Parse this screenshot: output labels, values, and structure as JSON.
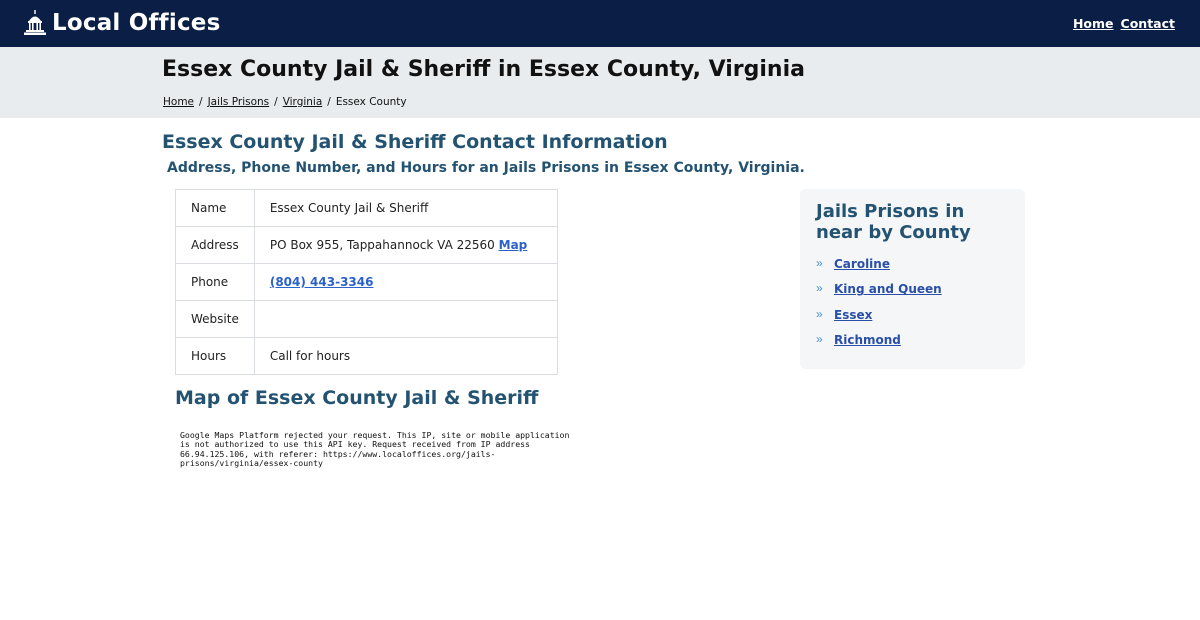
{
  "header": {
    "brand": "Local Offices",
    "brand_icon": "capitol-building-icon",
    "nav": {
      "home": "Home",
      "contact": "Contact"
    }
  },
  "hero": {
    "title": "Essex County Jail & Sheriff in Essex County, Virginia",
    "breadcrumb": [
      "Home",
      "Jails Prisons",
      "Virginia",
      "Essex County"
    ]
  },
  "main": {
    "section_title": "Essex County Jail & Sheriff Contact Information",
    "section_subtitle": "Address, Phone Number, and Hours for an Jails Prisons in Essex County, Virginia.",
    "table": {
      "rows": [
        {
          "label": "Name",
          "value": "Essex County Jail & Sheriff"
        },
        {
          "label": "Address",
          "value": "PO Box 955, Tappahannock VA 22560",
          "link": "Map"
        },
        {
          "label": "Phone",
          "link": "(804) 443-3346"
        },
        {
          "label": "Website",
          "value": ""
        },
        {
          "label": "Hours",
          "value": "Call for hours"
        }
      ]
    },
    "map_title": "Map of Essex County Jail & Sheriff",
    "map_error": "Google Maps Platform rejected your request. This IP, site or mobile application is not authorized to use this API key. Request received from IP address 66.94.125.106, with referer: https://www.localoffices.org/jails-prisons/virginia/essex-county"
  },
  "sidebar": {
    "title": "Jails Prisons in near by County",
    "items": [
      "Caroline",
      "King and Queen",
      "Essex",
      "Richmond"
    ],
    "chevron_icon": "double-chevron-right-icon"
  },
  "colors": {
    "navbar": "#0b1f46",
    "hero_bg": "#e9ecef",
    "heading": "#245372",
    "link": "#2a62c9"
  }
}
